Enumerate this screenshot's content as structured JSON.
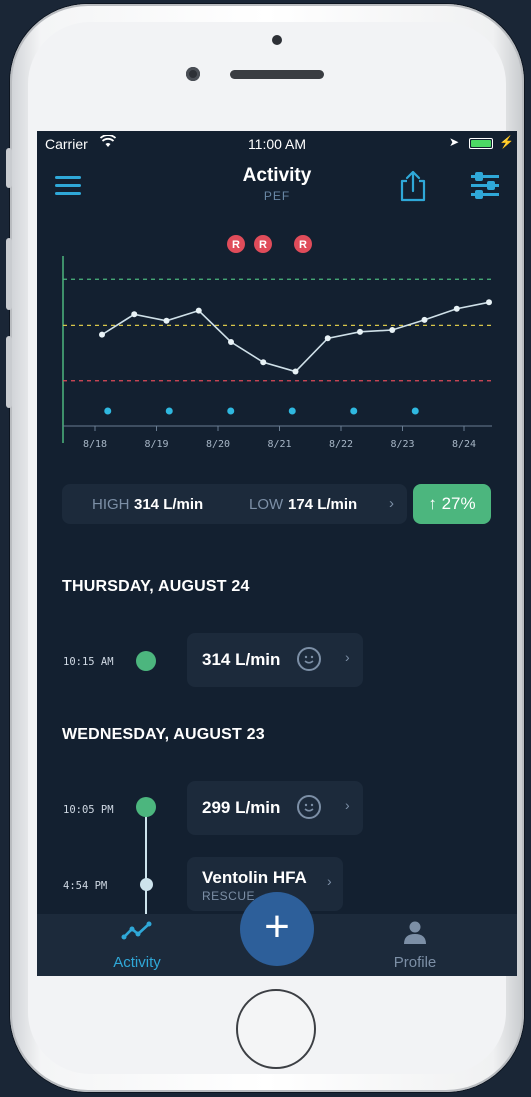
{
  "status_bar": {
    "carrier": "Carrier",
    "time": "11:00 AM"
  },
  "nav": {
    "title": "Activity",
    "subtitle": "PEF"
  },
  "chart_data": {
    "type": "line",
    "x": [
      "8/18",
      "8/18",
      "8/19",
      "8/19",
      "8/20",
      "8/20",
      "8/20",
      "8/21",
      "8/21",
      "8/21",
      "8/22",
      "8/22",
      "8/23",
      "8/23",
      "8/24",
      "8/24"
    ],
    "x_tick_labels": [
      "8/18",
      "8/19",
      "8/20",
      "8/21",
      "8/22",
      "8/23",
      "8/24"
    ],
    "values": [
      240,
      262,
      255,
      266,
      232,
      210,
      200,
      236,
      243,
      245,
      256,
      268,
      275
    ],
    "reference_lines": {
      "green": 300,
      "yellow": 250,
      "red": 190
    },
    "rescue_markers": [
      "R",
      "R",
      "R"
    ],
    "event_dots": [
      "8/18",
      "8/19",
      "8/20",
      "8/21",
      "8/22",
      "8/23"
    ],
    "colors": {
      "line": "#cfe0e8",
      "green": "#4cb67e",
      "yellow": "#d9c64a",
      "red": "#e04c5a",
      "marker": "#e04c5a",
      "event": "#2fb8e0"
    }
  },
  "stats": {
    "high_label": "HIGH",
    "high_value": "314 L/min",
    "low_label": "LOW",
    "low_value": "174 L/min",
    "change": "↑ 27%"
  },
  "days": [
    {
      "header": "THURSDAY, AUGUST 24",
      "entries": [
        {
          "time": "10:15 AM",
          "value": "314 L/min",
          "icon": "smile-icon"
        }
      ]
    },
    {
      "header": "WEDNESDAY, AUGUST 23",
      "entries": [
        {
          "time": "10:05 PM",
          "value": "299 L/min",
          "icon": "smile-icon"
        },
        {
          "time": "4:54 PM",
          "value": "Ventolin HFA",
          "subtitle": "RESCUE"
        }
      ]
    }
  ],
  "tabbar": {
    "activity_label": "Activity",
    "profile_label": "Profile",
    "fab_label": "+"
  },
  "colors": {
    "background": "#132030",
    "card": "#1c2a3b",
    "accent": "#2fa8d8",
    "green": "#4cb67e",
    "fab": "#2d5f9a"
  }
}
